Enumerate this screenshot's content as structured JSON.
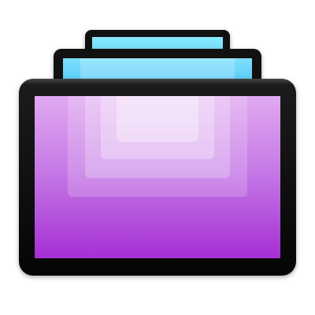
{
  "app_icon": {
    "icon_name": "screens-stack-icon",
    "colors": {
      "bezel": "#111111",
      "back_display": "#5fd3f7",
      "middle_display": "#42bff0",
      "front_display_top": "#e0a9f0",
      "front_display_bottom": "#a52fd3",
      "background": "#ffffff"
    }
  }
}
